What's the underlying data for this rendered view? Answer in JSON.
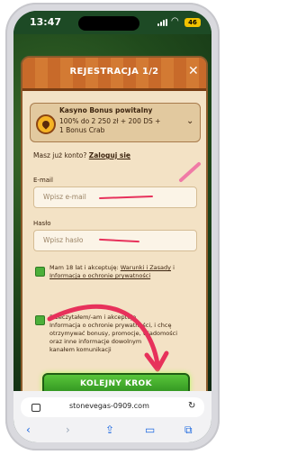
{
  "status_bar": {
    "time": "13:47",
    "battery": "46"
  },
  "modal": {
    "title": "REJESTRACJA 1/2",
    "close": "✕"
  },
  "bonus": {
    "title": "Kasyno Bonus powitalny",
    "line1": "100% do 2 250 zł + 200 DS +",
    "line2": "1 Bonus Crab",
    "chevron": "⌄"
  },
  "account": {
    "prompt": "Masz już konto?",
    "login": "Zaloguj się"
  },
  "email": {
    "label": "E-mail",
    "placeholder": "Wpisz e-mail"
  },
  "password": {
    "label": "Hasło",
    "placeholder": "Wpisz hasło"
  },
  "consent1": {
    "a": "Mam 18 lat i akceptuję:",
    "b": "Warunki i Zasady",
    "c": "i",
    "d": "Informacja o ochronie prywatności"
  },
  "consent2": {
    "l1": "Przeczytałem/-am i akceptuje",
    "l2": "Informacja o ochronie prywatności, i chcę",
    "l3": "otrzymywać bonusy, promocje, wiadomości",
    "l4": "oraz inne informacje dowolnym",
    "l5": "kanałem komunikacji"
  },
  "cta": {
    "label": "KOLEJNY KROK"
  },
  "browser": {
    "url": "stonevegas-0909.com"
  },
  "colors": {
    "accent": "#e7315b",
    "cta": "#3ea52a",
    "header": "#c86a2a"
  }
}
